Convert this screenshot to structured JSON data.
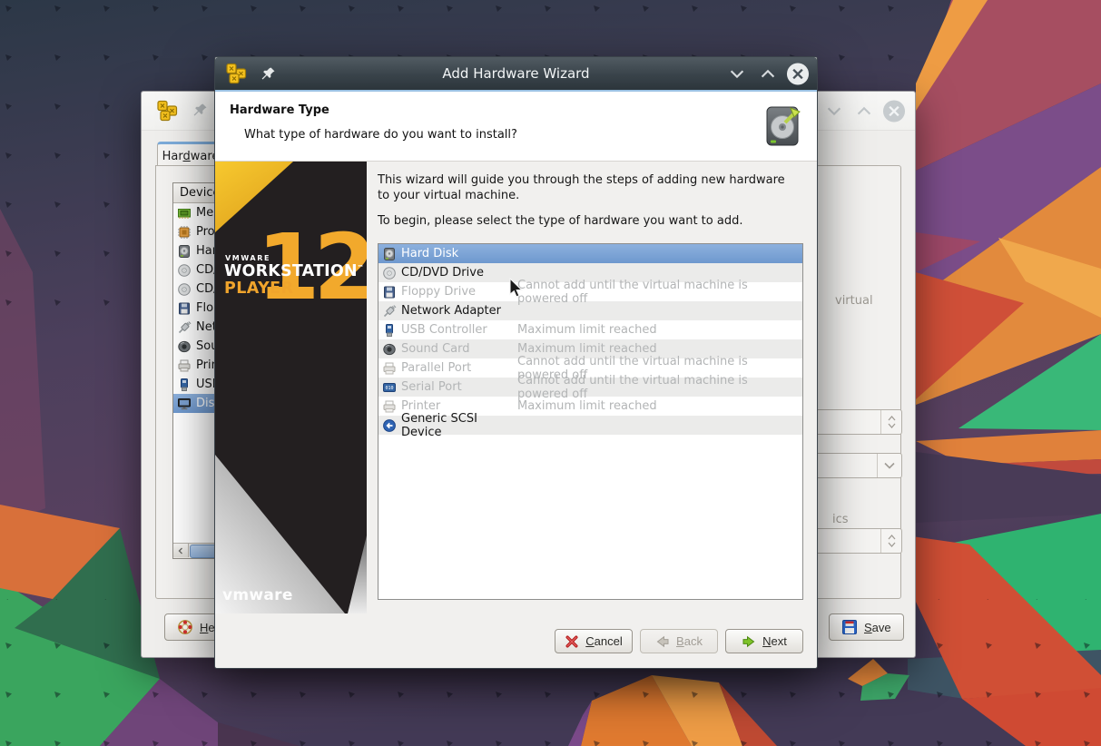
{
  "colors": {
    "selection_blue_top": "#8db1de",
    "selection_blue_bottom": "#6e98ce",
    "titlebar_dark_top": "#515b62",
    "titlebar_dark_bottom": "#2c353b",
    "titlebar_accent": "#9cc2e4",
    "brand_yellow": "#f2a92c",
    "next_arrow_green": "#73b516",
    "cancel_red": "#c42222",
    "disabled_text": "#b3b5b6",
    "dialog_bg": "#efeeec"
  },
  "wizard": {
    "title": "Add Hardware Wizard",
    "header_title": "Hardware Type",
    "header_subtitle": "What type of hardware do you want to install?",
    "header_icon": "hard-disk-drive-icon",
    "intro_para1": "This wizard will guide you through the steps of adding new hardware to your virtual machine.",
    "intro_para2": "To begin, please select the type of hardware you want to add.",
    "branding": {
      "vmware_small": "VMWARE",
      "workstation": "WORKSTATION",
      "tm": "™",
      "player": "PLAYER",
      "version": "12",
      "logo": "vmware"
    },
    "hardware_list": [
      {
        "label": "Hard Disk",
        "note": "",
        "state": "selected",
        "icon": "hard-disk-icon"
      },
      {
        "label": "CD/DVD Drive",
        "note": "",
        "state": "enabled",
        "icon": "cd-dvd-icon"
      },
      {
        "label": "Floppy Drive",
        "note": "Cannot add until the virtual machine is powered off",
        "state": "disabled",
        "icon": "floppy-icon"
      },
      {
        "label": "Network Adapter",
        "note": "",
        "state": "enabled",
        "icon": "network-icon"
      },
      {
        "label": "USB Controller",
        "note": "Maximum limit reached",
        "state": "disabled",
        "icon": "usb-icon"
      },
      {
        "label": "Sound Card",
        "note": "Maximum limit reached",
        "state": "disabled",
        "icon": "sound-icon"
      },
      {
        "label": "Parallel Port",
        "note": "Cannot add until the virtual machine is powered off",
        "state": "disabled",
        "icon": "parallel-port-icon"
      },
      {
        "label": "Serial Port",
        "note": "Cannot add until the virtual machine is powered off",
        "state": "disabled",
        "icon": "serial-port-icon"
      },
      {
        "label": "Printer",
        "note": "Maximum limit reached",
        "state": "disabled",
        "icon": "printer-icon"
      },
      {
        "label": "Generic SCSI Device",
        "note": "",
        "state": "enabled",
        "icon": "scsi-icon"
      }
    ],
    "buttons": {
      "cancel": "Cancel",
      "back": "Back",
      "next": "Next"
    }
  },
  "settings": {
    "tab_label": "Hardware",
    "device_header": "Device",
    "devices": [
      {
        "label": "Memory",
        "icon": "memory-icon"
      },
      {
        "label": "Processors",
        "icon": "processor-icon"
      },
      {
        "label": "Hard Disk",
        "icon": "hard-disk-icon"
      },
      {
        "label": "CD/DVD",
        "icon": "cd-dvd-icon"
      },
      {
        "label": "CD/DVD",
        "icon": "cd-dvd-icon"
      },
      {
        "label": "Floppy",
        "icon": "floppy-icon"
      },
      {
        "label": "Network",
        "icon": "network-icon"
      },
      {
        "label": "Sound",
        "icon": "sound-icon"
      },
      {
        "label": "Printer",
        "icon": "printer-icon"
      },
      {
        "label": "USB",
        "icon": "usb-icon"
      },
      {
        "label": "Display",
        "icon": "display-icon",
        "state": "selected"
      }
    ],
    "fragments": {
      "virtual_text": "virtual",
      "memory_text": "ics memory:"
    },
    "buttons": {
      "help": "Help",
      "save": "Save"
    }
  }
}
